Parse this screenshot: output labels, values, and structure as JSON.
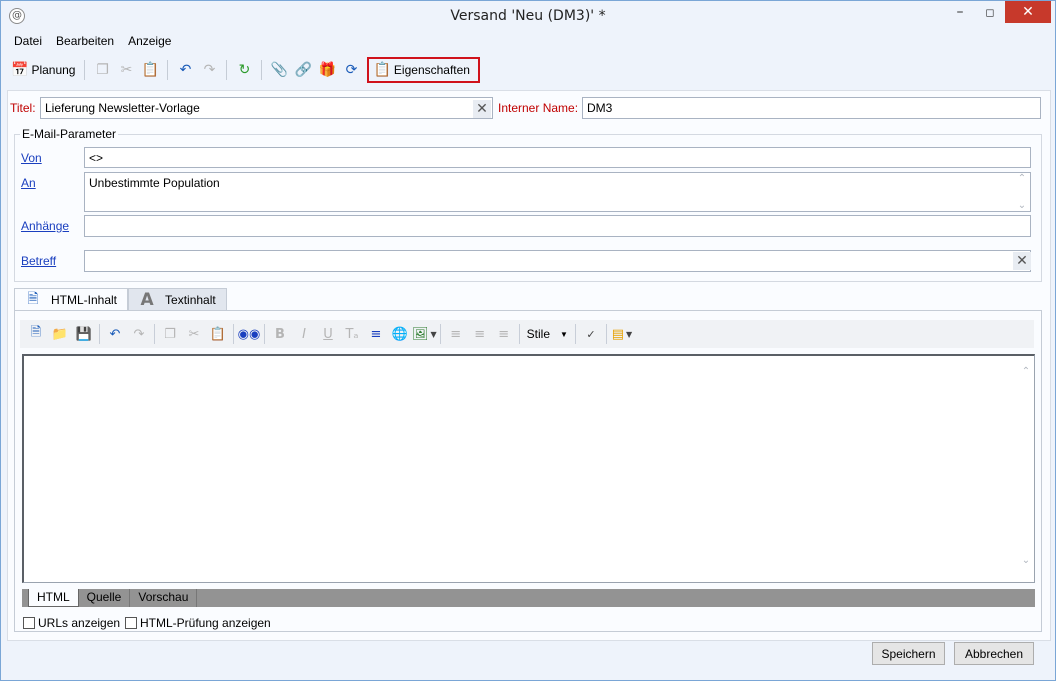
{
  "window": {
    "title": "Versand 'Neu (DM3)' *",
    "app_icon": "app-logo-icon"
  },
  "menu": [
    "Datei",
    "Bearbeiten",
    "Anzeige"
  ],
  "toolbar": {
    "planung": "Planung",
    "eigenschaften": "Eigenschaften"
  },
  "form": {
    "titel_label": "Titel:",
    "titel_value": "Lieferung Newsletter-Vorlage",
    "interner_label": "Interner Name:",
    "interner_value": "DM3",
    "group_label": "E-Mail-Parameter",
    "von_label": "Von",
    "von_value": "<>",
    "an_label": "An",
    "an_value": "Unbestimmte Population",
    "anhaenge_label": "Anhänge",
    "anhaenge_value": "",
    "betreff_label": "Betreff",
    "betreff_value": ""
  },
  "tabs": [
    "HTML-Inhalt",
    "Textinhalt"
  ],
  "editor": {
    "stile": "Stile",
    "modes": [
      "HTML",
      "Quelle",
      "Vorschau"
    ]
  },
  "checks": [
    "URLs anzeigen",
    "HTML-Prüfung anzeigen"
  ],
  "buttons": {
    "save": "Speichern",
    "cancel": "Abbrechen"
  },
  "colors": {
    "highlight": "#d0121b",
    "required": "#c00000",
    "link": "#1a3fbf",
    "close": "#c7392b"
  }
}
